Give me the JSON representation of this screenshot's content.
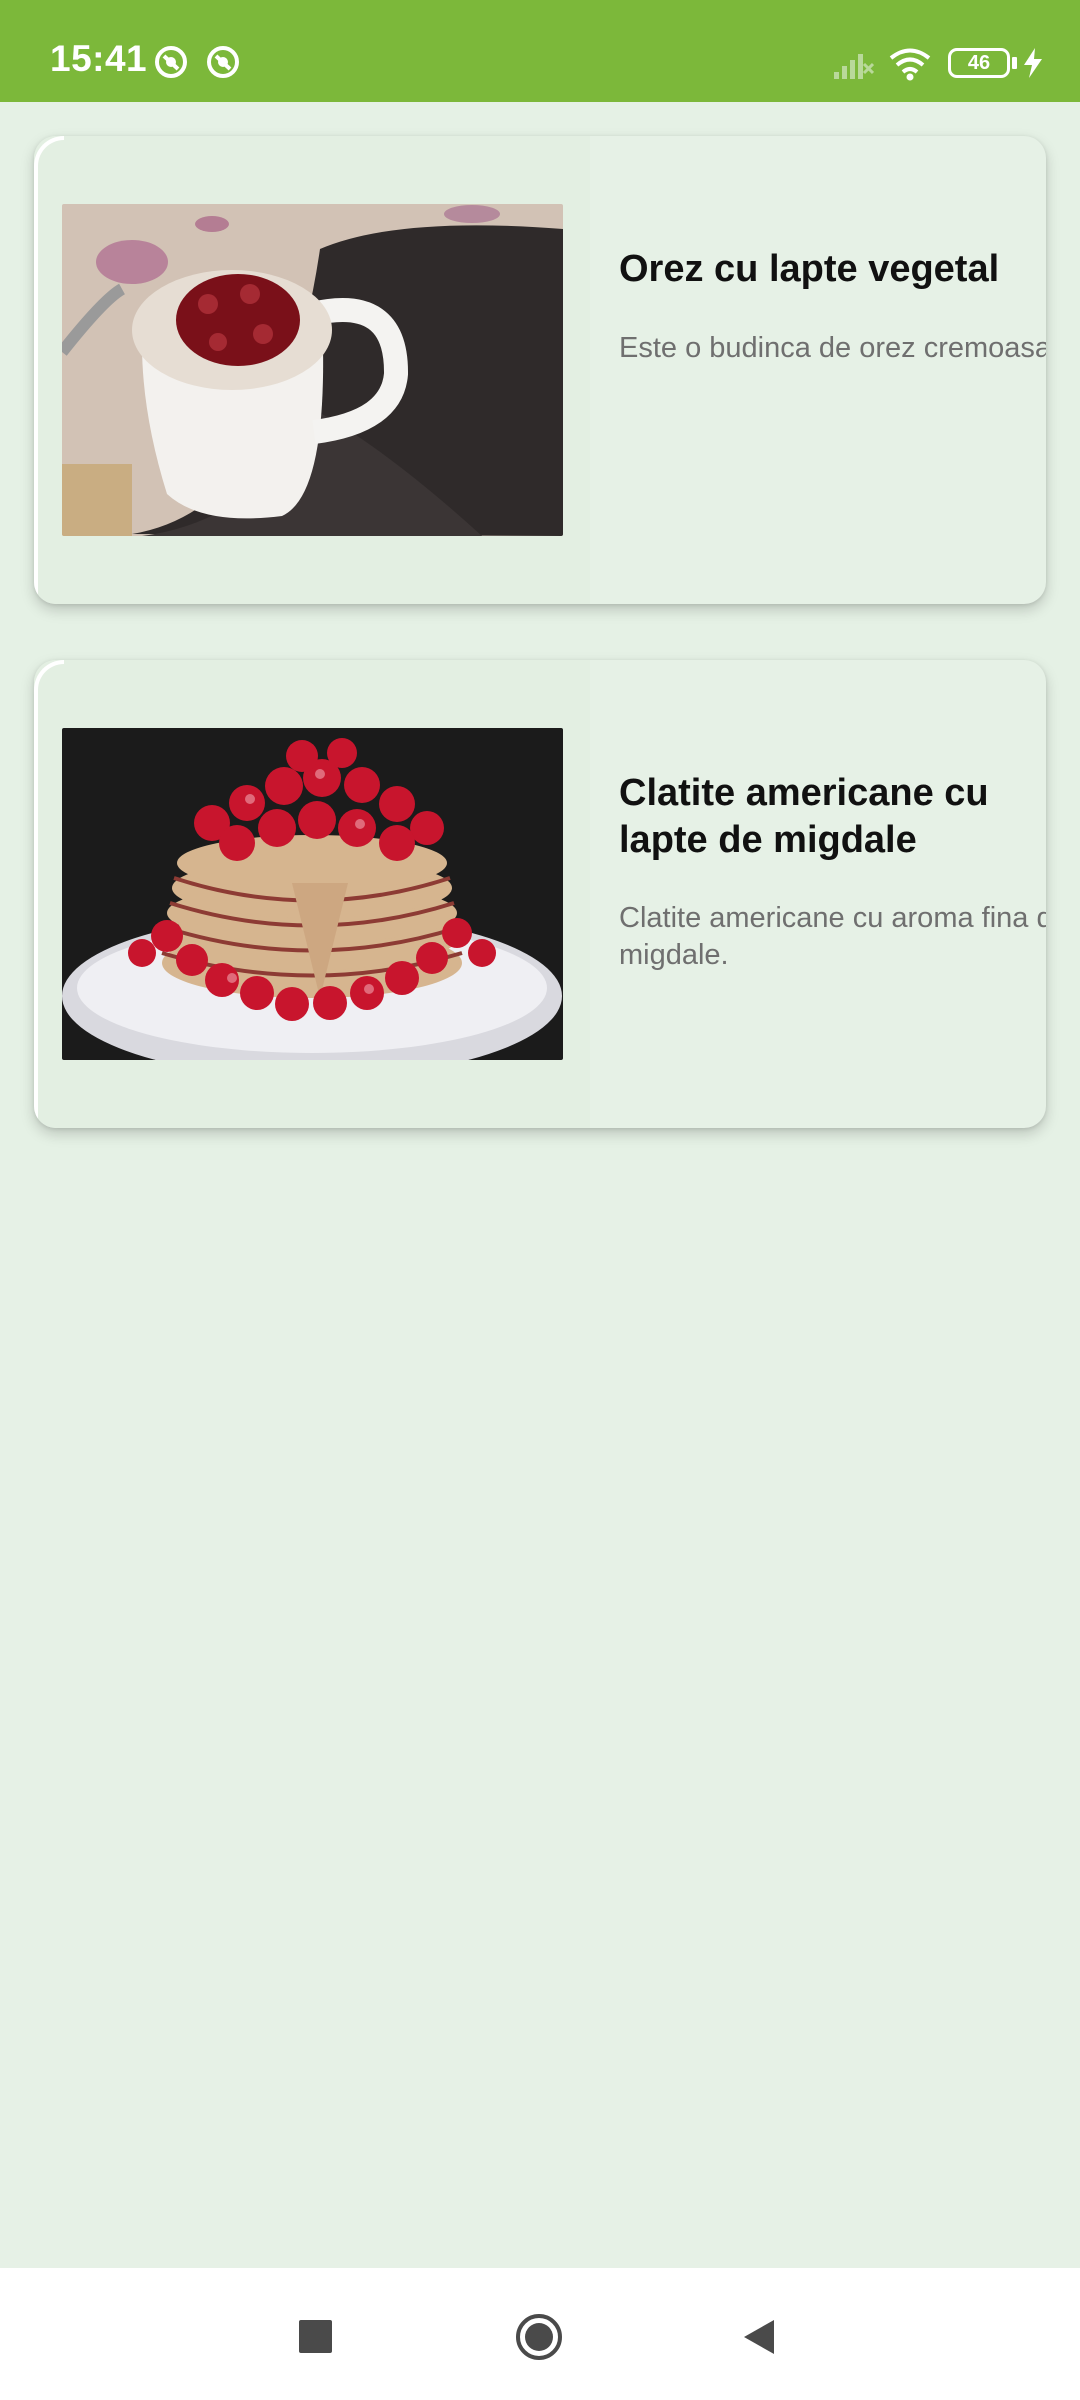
{
  "status_bar": {
    "time": "15:41",
    "battery_level": "46",
    "icons": [
      "app-notification-icon",
      "app-notification-icon",
      "signal-icon",
      "wifi-icon",
      "battery-icon",
      "charging-icon"
    ]
  },
  "recipes": [
    {
      "title": "Orez cu lapte vegetal",
      "description": "Este o budinca de orez cremoasa.",
      "image_icon": "rice-pudding-photo"
    },
    {
      "title": "Clatite americane cu lapte de migdale",
      "description": "Clatite americane cu aroma fina de migdale.",
      "image_icon": "raspberry-pancakes-photo"
    }
  ],
  "nav_bar": {
    "icons": [
      "recents-square-icon",
      "home-circle-icon",
      "back-triangle-icon"
    ]
  },
  "colors": {
    "status_bar": "#7cb83a",
    "background": "#e6f1e6",
    "card": "#e6f1e6",
    "title_text": "#111111",
    "description_text": "#6f6f6f"
  }
}
